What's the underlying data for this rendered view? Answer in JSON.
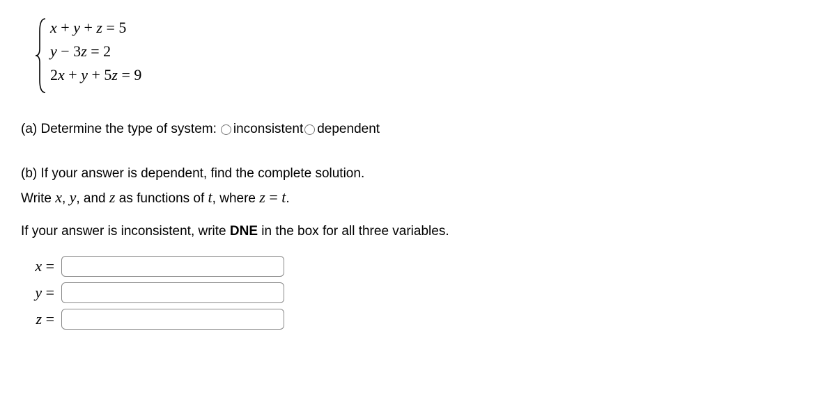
{
  "system": {
    "eq1": "x + y + z = 5",
    "eq2": "y − 3z = 2",
    "eq3": "2x + y + 5z = 9"
  },
  "partA": {
    "prompt": "(a) Determine the type of system: ",
    "options": {
      "inconsistent": "inconsistent",
      "dependent": "dependent"
    }
  },
  "partB": {
    "line1_pre": "(b) If your answer is dependent, find the complete solution.",
    "line2_pre": "Write ",
    "line2_mid1": ", ",
    "line2_mid2": ", and ",
    "line2_mid3": " as functions of ",
    "line2_mid4": ", where ",
    "line2_end": ".",
    "var_x": "x",
    "var_y": "y",
    "var_z": "z",
    "var_t": "t",
    "zt_expr": "z = t",
    "line3_pre": "If your answer is inconsistent, write ",
    "dne": "DNE",
    "line3_post": " in the box for all three variables."
  },
  "answers": {
    "x_label": "x =",
    "y_label": "y =",
    "z_label": "z =",
    "x_value": "",
    "y_value": "",
    "z_value": ""
  }
}
